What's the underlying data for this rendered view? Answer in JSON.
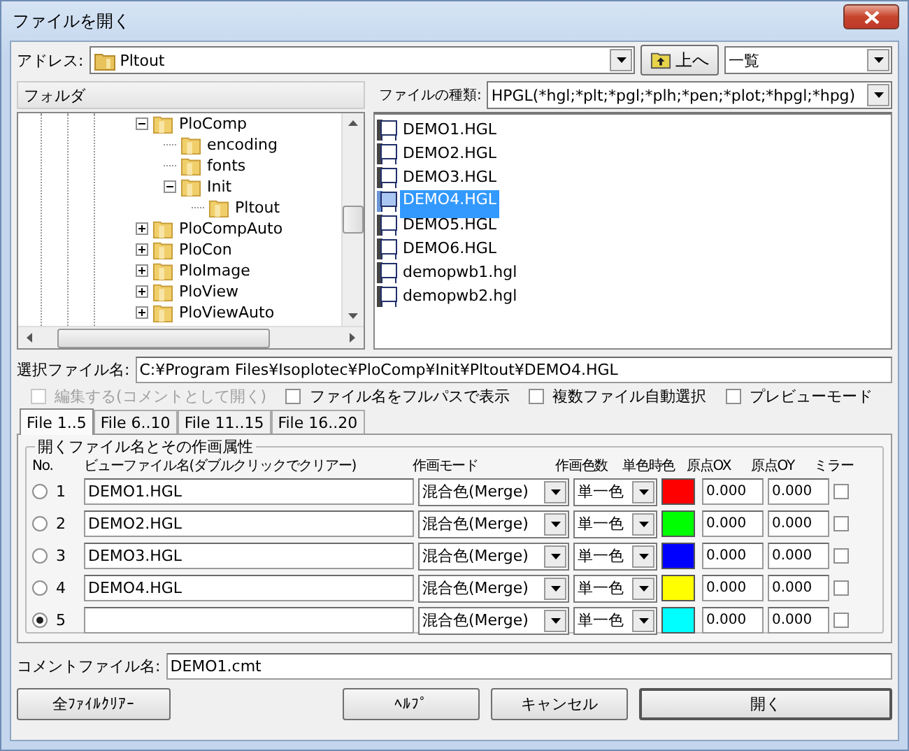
{
  "window": {
    "title": "ファイルを開く"
  },
  "address": {
    "label": "アドレス:",
    "value": "Pltout",
    "up_button": "上へ",
    "view": "一覧"
  },
  "folder_header": "フォルダ",
  "file_type": {
    "label": "ファイルの種類:",
    "value": "HPGL(*hgl;*plt;*pgl;*plh;*pen;*plot;*hpgl;*hpg)"
  },
  "tree": {
    "items": [
      {
        "label": "PloComp",
        "expanded": true,
        "children": [
          {
            "label": "encoding"
          },
          {
            "label": "fonts"
          },
          {
            "label": "Init",
            "expanded": true,
            "children": [
              {
                "label": "Pltout"
              }
            ]
          }
        ]
      },
      {
        "label": "PloCompAuto",
        "expanded": false
      },
      {
        "label": "PloCon",
        "expanded": false
      },
      {
        "label": "PloImage",
        "expanded": false
      },
      {
        "label": "PloView",
        "expanded": false
      },
      {
        "label": "PloViewAuto",
        "expanded": false
      }
    ]
  },
  "files": [
    {
      "name": "DEMO1.HGL",
      "selected": false
    },
    {
      "name": "DEMO2.HGL",
      "selected": false
    },
    {
      "name": "DEMO3.HGL",
      "selected": false
    },
    {
      "name": "DEMO4.HGL",
      "selected": true
    },
    {
      "name": "DEMO5.HGL",
      "selected": false
    },
    {
      "name": "DEMO6.HGL",
      "selected": false
    },
    {
      "name": "demopwb1.hgl",
      "selected": false
    },
    {
      "name": "demopwb2.hgl",
      "selected": false
    }
  ],
  "selected_file": {
    "label": "選択ファイル名:",
    "value": "C:¥Program Files¥Isoplotec¥PloComp¥Init¥Pltout¥DEMO4.HGL"
  },
  "options": [
    {
      "label": "編集する(コメントとして開く)",
      "checked": false,
      "disabled": true
    },
    {
      "label": "ファイル名をフルパスで表示",
      "checked": false,
      "disabled": false
    },
    {
      "label": "複数ファイル自動選択",
      "checked": false,
      "disabled": false
    },
    {
      "label": "プレビューモード",
      "checked": false,
      "disabled": false
    }
  ],
  "tabs": [
    {
      "label": "File 1..5",
      "selected": true
    },
    {
      "label": "File 6..10",
      "selected": false
    },
    {
      "label": "File 11..15",
      "selected": false
    },
    {
      "label": "File 16..20",
      "selected": false
    }
  ],
  "group": {
    "title": "開くファイル名とその作画属性",
    "columns": [
      "No.",
      "ビューファイル名(ダブルクリックでクリアー)",
      "作画モード",
      "作画色数",
      "単色時色",
      "原点OX",
      "原点OY",
      "ミラー"
    ],
    "rows": [
      {
        "selected": false,
        "no": "1",
        "file": "DEMO1.HGL",
        "mode": "混合色(Merge)",
        "colors": "単一色",
        "color": "#ff0000",
        "ox": "0.000",
        "oy": "0.000",
        "mirror": false
      },
      {
        "selected": false,
        "no": "2",
        "file": "DEMO2.HGL",
        "mode": "混合色(Merge)",
        "colors": "単一色",
        "color": "#00ff00",
        "ox": "0.000",
        "oy": "0.000",
        "mirror": false
      },
      {
        "selected": false,
        "no": "3",
        "file": "DEMO3.HGL",
        "mode": "混合色(Merge)",
        "colors": "単一色",
        "color": "#0000ff",
        "ox": "0.000",
        "oy": "0.000",
        "mirror": false
      },
      {
        "selected": false,
        "no": "4",
        "file": "DEMO4.HGL",
        "mode": "混合色(Merge)",
        "colors": "単一色",
        "color": "#ffff00",
        "ox": "0.000",
        "oy": "0.000",
        "mirror": false
      },
      {
        "selected": true,
        "no": "5",
        "mode": "混合色(Merge)",
        "colors": "単一色",
        "color": "#00ffff",
        "ox": "0.000",
        "oy": "0.000",
        "mirror": false
      }
    ]
  },
  "comment": {
    "label": "コメントファイル名:",
    "value": "DEMO1.cmt"
  },
  "buttons": [
    {
      "label": "全ﾌｧｲﾙｸﾘｱｰ",
      "default": false
    },
    {
      "label": "ﾍﾙﾌﾟ",
      "default": false
    },
    {
      "label": "キャンセル",
      "default": false
    },
    {
      "label": "開く",
      "default": true
    }
  ]
}
